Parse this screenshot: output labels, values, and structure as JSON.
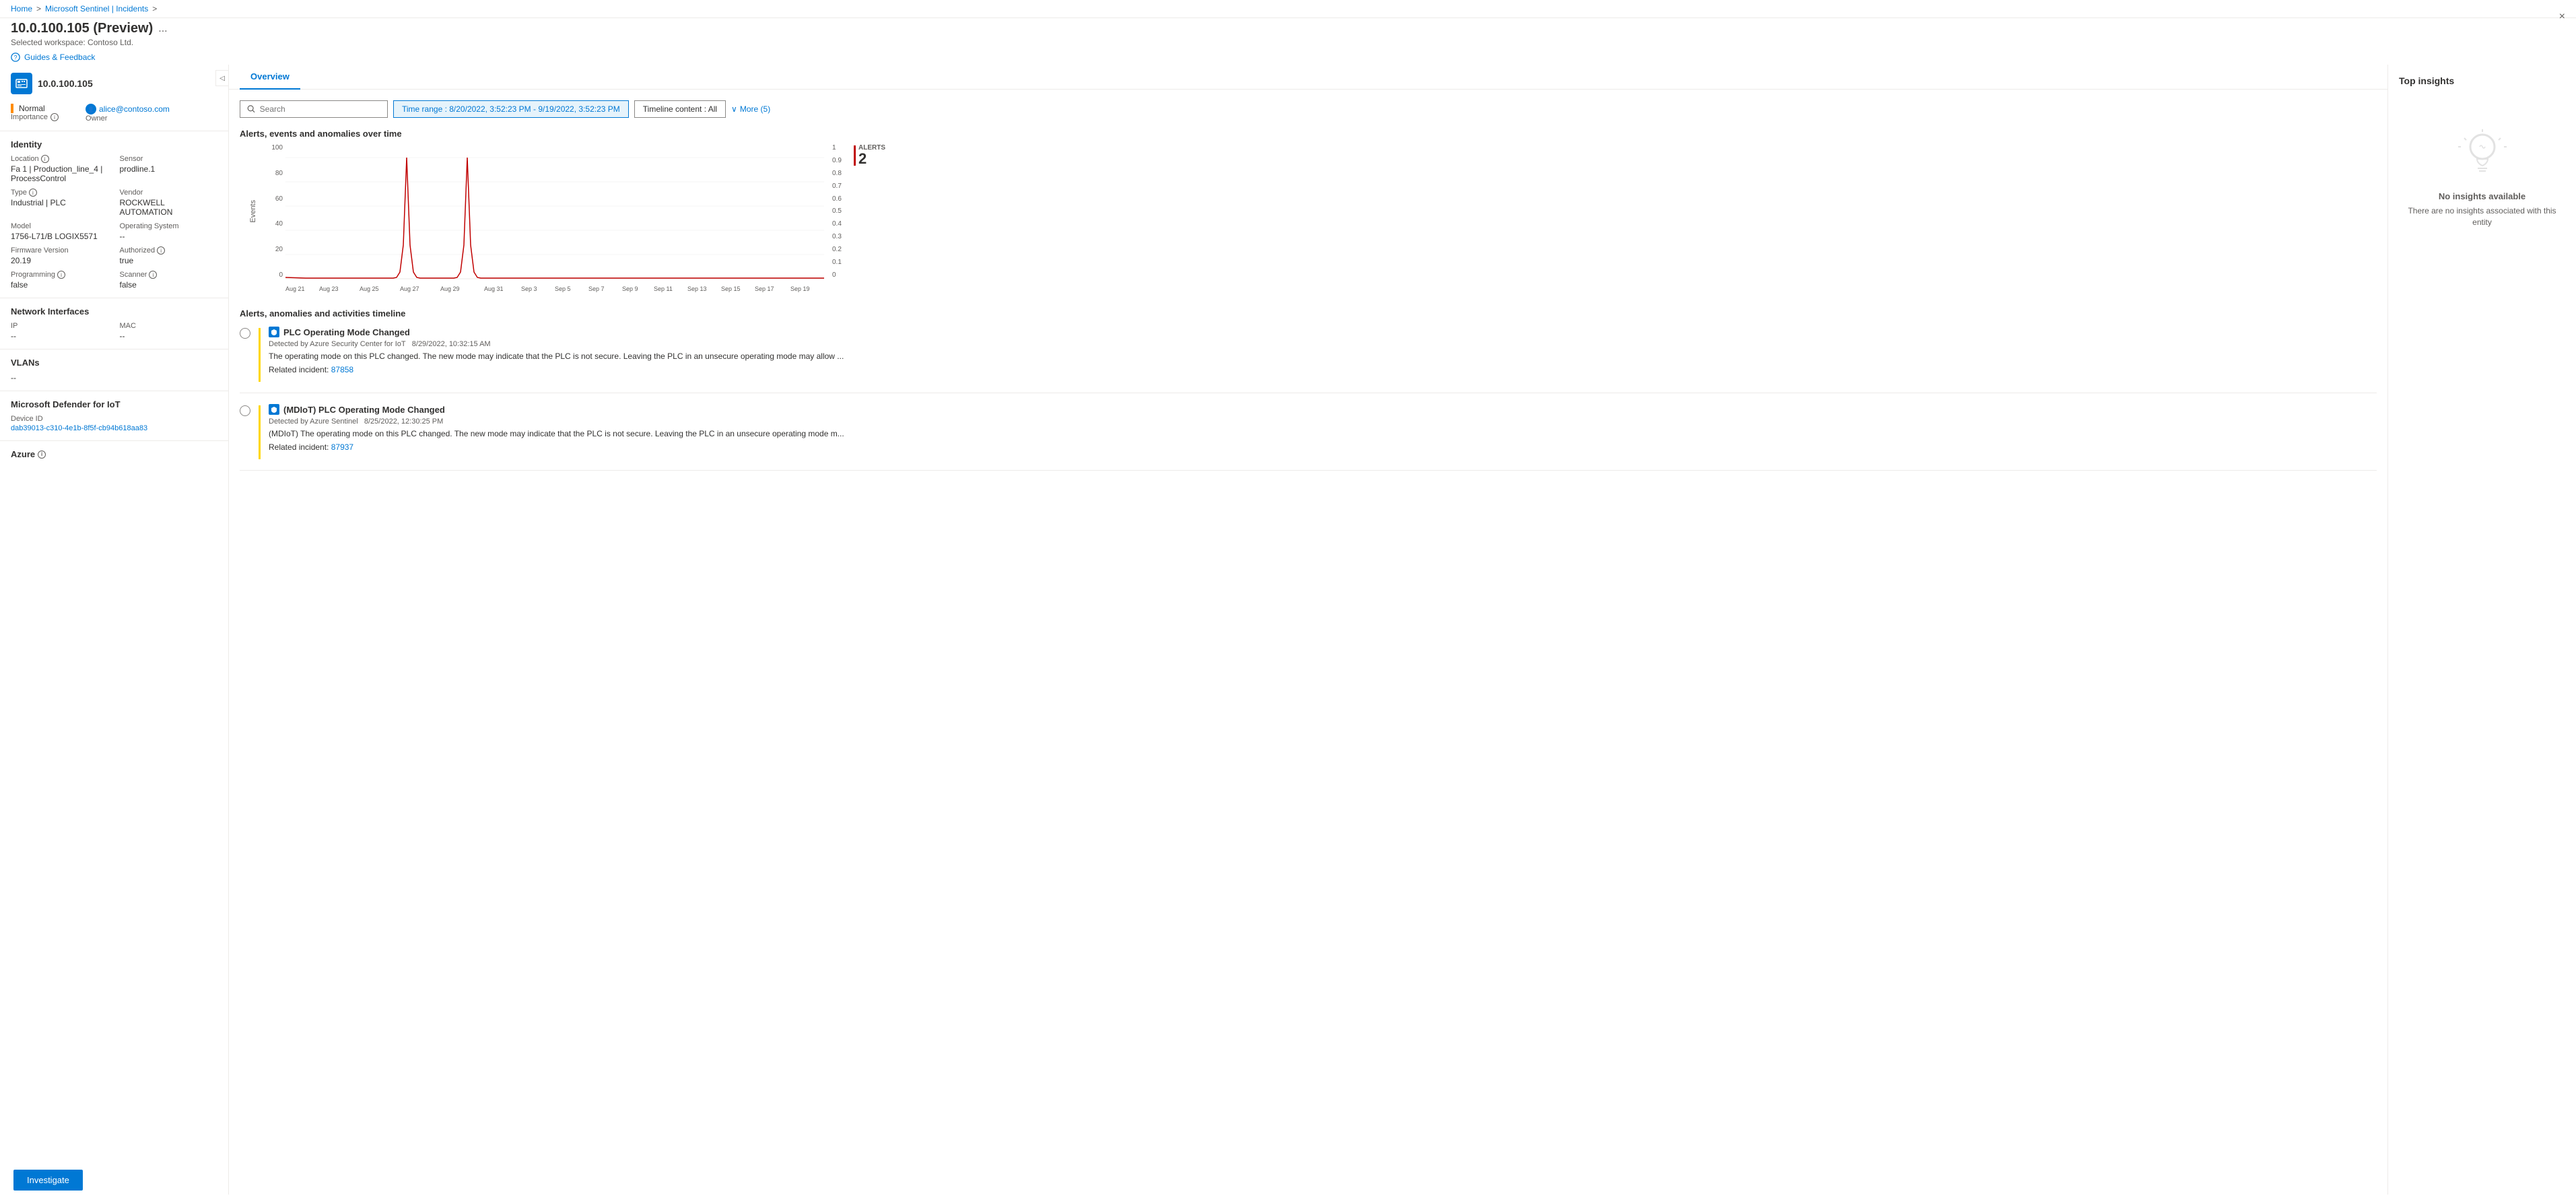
{
  "breadcrumb": {
    "home": "Home",
    "sentinel": "Microsoft Sentinel | Incidents",
    "separator": ">"
  },
  "page": {
    "title": "10.0.100.105 (Preview)",
    "subtitle": "Selected workspace: Contoso Ltd.",
    "close_label": "×",
    "guides_label": "Guides & Feedback",
    "more_icon": "..."
  },
  "device": {
    "name": "10.0.100.105",
    "status": "Normal",
    "status_label": "Importance",
    "owner": "alice@contoso.com",
    "owner_label": "Owner"
  },
  "identity": {
    "section_title": "Identity",
    "location_label": "Location",
    "location_value": "Fa 1 | Production_line_4 | ProcessControl",
    "sensor_label": "Sensor",
    "sensor_value": "prodline.1",
    "type_label": "Type",
    "type_value": "Industrial | PLC",
    "vendor_label": "Vendor",
    "vendor_value": "ROCKWELL AUTOMATION",
    "model_label": "Model",
    "model_value": "1756-L71/B LOGIX5571",
    "os_label": "Operating System",
    "os_value": "--",
    "firmware_label": "Firmware Version",
    "firmware_value": "20.19",
    "authorized_label": "Authorized",
    "authorized_value": "true",
    "programming_label": "Programming",
    "programming_value": "false",
    "scanner_label": "Scanner",
    "scanner_value": "false"
  },
  "network": {
    "section_title": "Network Interfaces",
    "ip_label": "IP",
    "ip_value": "--",
    "mac_label": "MAC",
    "mac_value": "--"
  },
  "vlans": {
    "section_title": "VLANs",
    "value": "--"
  },
  "defender": {
    "section_title": "Microsoft Defender for IoT",
    "device_id_label": "Device ID",
    "device_id_value": "dab39013-c310-4e1b-8f5f-cb94b618aa83"
  },
  "azure": {
    "section_title": "Azure"
  },
  "investigate_btn": "Investigate",
  "tabs": [
    {
      "id": "overview",
      "label": "Overview",
      "active": true
    }
  ],
  "filters": {
    "search_placeholder": "Search",
    "time_range_label": "Time range : 8/20/2022, 3:52:23 PM - 9/19/2022, 3:52:23 PM",
    "timeline_content_label": "Timeline content : All",
    "more_label": "More (5)"
  },
  "chart": {
    "title": "Alerts, events and anomalies over time",
    "y_label_left": "Events",
    "y_label_right": "Alerts",
    "y_ticks_left": [
      "100",
      "80",
      "60",
      "40",
      "20",
      "0"
    ],
    "y_ticks_right": [
      "1",
      "0.9",
      "0.8",
      "0.7",
      "0.6",
      "0.5",
      "0.4",
      "0.3",
      "0.2",
      "0.1",
      "0"
    ],
    "x_ticks": [
      "Aug 21",
      "Aug 23",
      "Aug 25",
      "Aug 27",
      "Aug 29",
      "Aug 31",
      "Sep 3",
      "Sep 5",
      "Sep 7",
      "Sep 9",
      "Sep 11",
      "Sep 13",
      "Sep 15",
      "Sep 17",
      "Sep 19"
    ],
    "alerts_count_label": "ALERTS",
    "alerts_count": "2"
  },
  "timeline": {
    "title": "Alerts, anomalies and activities timeline",
    "items": [
      {
        "title": "PLC Operating Mode Changed",
        "source": "Detected by Azure Security Center for IoT",
        "datetime": "8/29/2022, 10:32:15 AM",
        "description": "The operating mode on this PLC changed. The new mode may indicate that the PLC is not secure. Leaving the PLC in an unsecure operating mode may allow ...",
        "incident_label": "Related incident:",
        "incident_id": "87858",
        "incident_link": "#87858"
      },
      {
        "title": "(MDIoT) PLC Operating Mode Changed",
        "source": "Detected by Azure Sentinel",
        "datetime": "8/25/2022, 12:30:25 PM",
        "description": "(MDIoT) The operating mode on this PLC changed. The new mode may indicate that the PLC is not secure. Leaving the PLC in an unsecure operating mode m...",
        "incident_label": "Related incident:",
        "incident_id": "87937",
        "incident_link": "#87937"
      }
    ]
  },
  "insights": {
    "title": "Top insights",
    "no_insights_title": "No insights available",
    "no_insights_desc": "There are no insights associated with this entity"
  }
}
